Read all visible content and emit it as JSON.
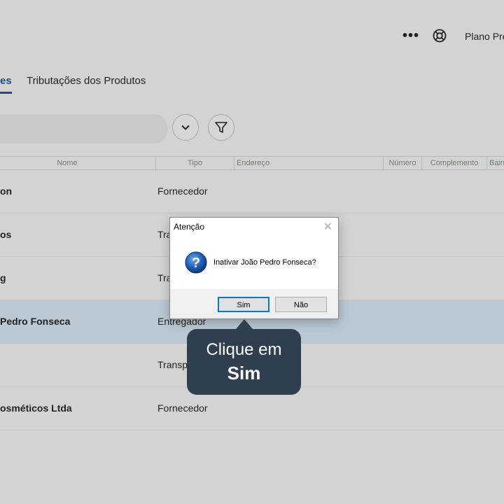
{
  "header": {
    "more_icon": "more-horizontal-icon",
    "help_icon": "lifebuoy-icon",
    "plan_label": "Plano Pre"
  },
  "tabs": [
    {
      "label": "es",
      "active": true
    },
    {
      "label": "Tributações dos Produtos",
      "active": false
    }
  ],
  "toolbar": {
    "search_placeholder": "",
    "expand_icon": "chevron-down-icon",
    "filter_icon": "filter-icon"
  },
  "table": {
    "columns": [
      "Nome",
      "Tipo",
      "Endereço",
      "Número",
      "Complemento",
      "Bairr"
    ],
    "rows": [
      {
        "nome": "on",
        "tipo": "Fornecedor",
        "selected": false
      },
      {
        "nome": "os",
        "tipo": "Tra",
        "selected": false
      },
      {
        "nome": "g",
        "tipo": "Tra",
        "selected": false
      },
      {
        "nome": "Pedro Fonseca",
        "tipo": "Entregador",
        "selected": true
      },
      {
        "nome": "",
        "tipo": "Transp",
        "selected": false
      },
      {
        "nome": "osméticos Ltda",
        "tipo": "Fornecedor",
        "selected": false
      }
    ]
  },
  "dialog": {
    "title": "Atenção",
    "close_glyph": "✕",
    "icon": "question-icon",
    "message": "Inativar João Pedro Fonseca?",
    "yes_label": "Sim",
    "no_label": "Não"
  },
  "tooltip": {
    "line1": "Clique em",
    "line2": "Sim"
  },
  "colors": {
    "accent": "#1d4f82",
    "selected_row": "#b9c8d3",
    "tooltip_bg": "#2f3f4f"
  }
}
